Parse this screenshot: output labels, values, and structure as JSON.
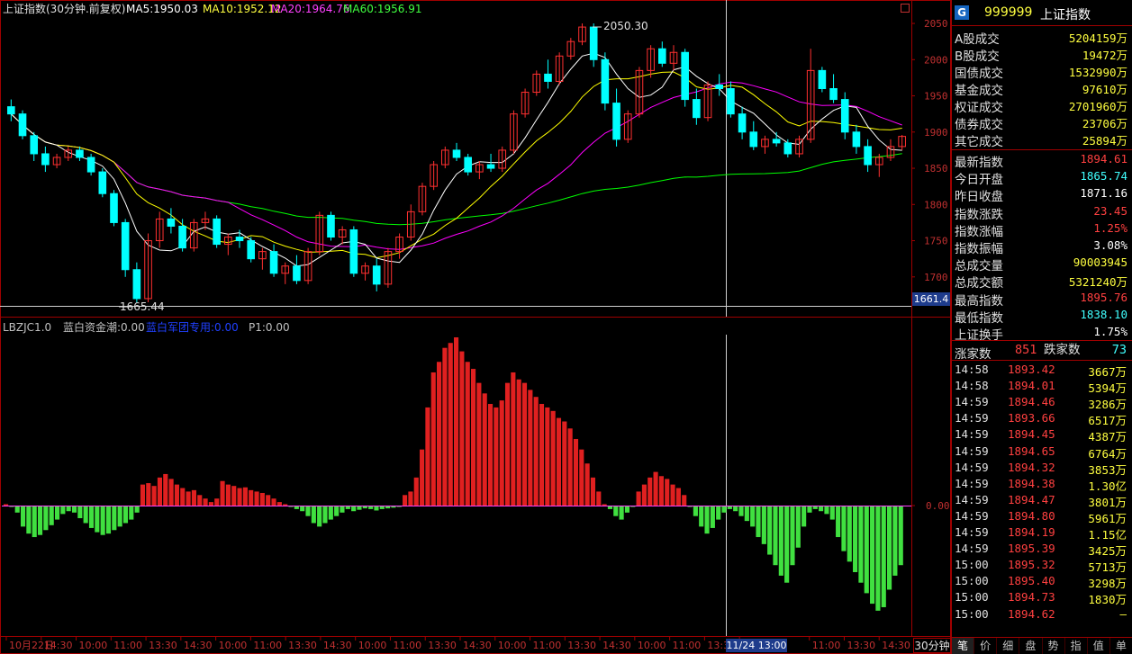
{
  "header": {
    "title": "上证指数(30分钟.前复权)",
    "ma5": "MA5:1950.03",
    "ma10": "MA10:1952.12",
    "ma20": "MA20:1964.76",
    "ma60": "MA60:1956.91"
  },
  "indicator_header": {
    "name": "LBZJC1.0",
    "lanbai": "蓝白资金潮:0.00",
    "team": "蓝白军团专用:0.00",
    "p1": "P1:0.00"
  },
  "annotations": {
    "high": "2050.30",
    "low": "1665.44",
    "crosshair_price": "1661.4",
    "crosshair_time": "11/24 13:00",
    "period_button": "30分钟"
  },
  "colors": {
    "up": "#ff3030",
    "down": "#00ffff",
    "ma5": "#ffffff",
    "ma10": "#ffff00",
    "ma20": "#ff00ff",
    "ma60": "#00ff00",
    "grid": "#a00000",
    "hist_up": "#e02020",
    "hist_down": "#40e040"
  },
  "panel": {
    "badge": "G",
    "code": "999999",
    "name": "上证指数",
    "stats": [
      {
        "label": "A股成交",
        "value": "5204159万",
        "color": "yellow"
      },
      {
        "label": "B股成交",
        "value": "19472万",
        "color": "yellow"
      },
      {
        "label": "国债成交",
        "value": "1532990万",
        "color": "yellow"
      },
      {
        "label": "基金成交",
        "value": "97610万",
        "color": "yellow"
      },
      {
        "label": "权证成交",
        "value": "2701960万",
        "color": "yellow"
      },
      {
        "label": "债券成交",
        "value": "23706万",
        "color": "yellow"
      },
      {
        "label": "其它成交",
        "value": "25894万",
        "color": "yellow"
      }
    ],
    "quotes": [
      {
        "label": "最新指数",
        "value": "1894.61",
        "color": "red"
      },
      {
        "label": "今日开盘",
        "value": "1865.74",
        "color": "cyan"
      },
      {
        "label": "昨日收盘",
        "value": "1871.16",
        "color": "white"
      },
      {
        "label": "指数涨跌",
        "value": "23.45",
        "color": "red"
      },
      {
        "label": "指数涨幅",
        "value": "1.25%",
        "color": "red"
      },
      {
        "label": "指数振幅",
        "value": "3.08%",
        "color": "white"
      },
      {
        "label": "总成交量",
        "value": "90003945",
        "color": "yellow"
      },
      {
        "label": "总成交额",
        "value": "5321240万",
        "color": "yellow"
      },
      {
        "label": "最高指数",
        "value": "1895.76",
        "color": "red"
      },
      {
        "label": "最低指数",
        "value": "1838.10",
        "color": "cyan"
      },
      {
        "label": "上证换手",
        "value": "1.75%",
        "color": "white"
      }
    ],
    "breadth": {
      "up_label": "涨家数",
      "up_value": "851",
      "down_label": "跌家数",
      "down_value": "73"
    },
    "ticks": [
      {
        "time": "14:58",
        "price": "1893.42",
        "vol": "3667万"
      },
      {
        "time": "14:58",
        "price": "1894.01",
        "vol": "5394万"
      },
      {
        "time": "14:59",
        "price": "1894.46",
        "vol": "3286万"
      },
      {
        "time": "14:59",
        "price": "1893.66",
        "vol": "6517万"
      },
      {
        "time": "14:59",
        "price": "1894.45",
        "vol": "4387万"
      },
      {
        "time": "14:59",
        "price": "1894.65",
        "vol": "6764万"
      },
      {
        "time": "14:59",
        "price": "1894.32",
        "vol": "3853万"
      },
      {
        "time": "14:59",
        "price": "1894.38",
        "vol": "1.30亿"
      },
      {
        "time": "14:59",
        "price": "1894.47",
        "vol": "3801万"
      },
      {
        "time": "14:59",
        "price": "1894.80",
        "vol": "5961万"
      },
      {
        "time": "14:59",
        "price": "1894.19",
        "vol": "1.15亿"
      },
      {
        "time": "14:59",
        "price": "1895.39",
        "vol": "3425万"
      },
      {
        "time": "15:00",
        "price": "1895.32",
        "vol": "5713万"
      },
      {
        "time": "15:00",
        "price": "1895.40",
        "vol": "3298万"
      },
      {
        "time": "15:00",
        "price": "1894.73",
        "vol": "1830万"
      },
      {
        "time": "15:00",
        "price": "1894.62",
        "vol": "—"
      }
    ],
    "tabs": [
      "笔",
      "价",
      "细",
      "盘",
      "势",
      "指",
      "值",
      "单"
    ]
  },
  "chart_data": [
    {
      "type": "candlestick",
      "title": "上证指数(30分钟.前复权)",
      "y_ticks": [
        "2050",
        "2000",
        "1950",
        "1900",
        "1850",
        "1800",
        "1750",
        "1700"
      ],
      "ylim": [
        1660,
        2060
      ],
      "x_ticks": [
        "10月22日",
        "14:30",
        "10:00",
        "11:00",
        "13:30",
        "14:30",
        "10:00",
        "11:00",
        "13:30",
        "14:30",
        "10:00",
        "11:00",
        "13:30",
        "14:30",
        "10:00",
        "11:00",
        "13:30",
        "14:30",
        "10:00",
        "11:00",
        "13:30",
        "14:30",
        "11/24 13:00",
        "11:00",
        "13:30",
        "14:30"
      ],
      "ohlc": [
        [
          1935,
          1945,
          1915,
          1925
        ],
        [
          1925,
          1930,
          1890,
          1895
        ],
        [
          1895,
          1900,
          1860,
          1870
        ],
        [
          1870,
          1880,
          1845,
          1855
        ],
        [
          1855,
          1870,
          1850,
          1865
        ],
        [
          1865,
          1880,
          1860,
          1875
        ],
        [
          1875,
          1880,
          1860,
          1865
        ],
        [
          1865,
          1870,
          1840,
          1845
        ],
        [
          1845,
          1850,
          1810,
          1815
        ],
        [
          1815,
          1820,
          1770,
          1775
        ],
        [
          1775,
          1780,
          1700,
          1710
        ],
        [
          1710,
          1720,
          1665,
          1670
        ],
        [
          1670,
          1760,
          1665,
          1750
        ],
        [
          1750,
          1790,
          1740,
          1780
        ],
        [
          1780,
          1795,
          1760,
          1770
        ],
        [
          1770,
          1780,
          1735,
          1740
        ],
        [
          1740,
          1780,
          1735,
          1775
        ],
        [
          1775,
          1790,
          1765,
          1780
        ],
        [
          1780,
          1785,
          1740,
          1745
        ],
        [
          1745,
          1760,
          1730,
          1755
        ],
        [
          1755,
          1765,
          1740,
          1750
        ],
        [
          1750,
          1755,
          1720,
          1725
        ],
        [
          1725,
          1740,
          1710,
          1735
        ],
        [
          1735,
          1745,
          1700,
          1705
        ],
        [
          1705,
          1720,
          1690,
          1715
        ],
        [
          1715,
          1730,
          1690,
          1695
        ],
        [
          1695,
          1740,
          1690,
          1735
        ],
        [
          1735,
          1790,
          1730,
          1785
        ],
        [
          1785,
          1790,
          1750,
          1755
        ],
        [
          1755,
          1770,
          1745,
          1765
        ],
        [
          1765,
          1770,
          1700,
          1705
        ],
        [
          1705,
          1720,
          1695,
          1715
        ],
        [
          1715,
          1725,
          1680,
          1690
        ],
        [
          1690,
          1740,
          1685,
          1735
        ],
        [
          1735,
          1760,
          1725,
          1755
        ],
        [
          1755,
          1800,
          1750,
          1790
        ],
        [
          1790,
          1830,
          1785,
          1825
        ],
        [
          1825,
          1860,
          1820,
          1855
        ],
        [
          1855,
          1880,
          1850,
          1875
        ],
        [
          1875,
          1885,
          1860,
          1865
        ],
        [
          1865,
          1870,
          1840,
          1845
        ],
        [
          1845,
          1860,
          1835,
          1855
        ],
        [
          1855,
          1870,
          1845,
          1850
        ],
        [
          1850,
          1880,
          1845,
          1875
        ],
        [
          1875,
          1930,
          1870,
          1925
        ],
        [
          1925,
          1960,
          1920,
          1955
        ],
        [
          1955,
          1985,
          1950,
          1980
        ],
        [
          1980,
          2000,
          1960,
          1970
        ],
        [
          1970,
          2010,
          1965,
          2005
        ],
        [
          2005,
          2030,
          2000,
          2025
        ],
        [
          2025,
          2050,
          2020,
          2045
        ],
        [
          2045,
          2050,
          1990,
          2000
        ],
        [
          2000,
          2010,
          1930,
          1940
        ],
        [
          1940,
          1960,
          1880,
          1890
        ],
        [
          1890,
          1930,
          1885,
          1925
        ],
        [
          1925,
          1990,
          1920,
          1985
        ],
        [
          1985,
          2020,
          1975,
          2015
        ],
        [
          2015,
          2025,
          1990,
          1995
        ],
        [
          1995,
          2020,
          1985,
          2010
        ],
        [
          2010,
          2015,
          1935,
          1945
        ],
        [
          1945,
          1960,
          1910,
          1920
        ],
        [
          1920,
          1970,
          1915,
          1965
        ],
        [
          1965,
          1980,
          1950,
          1960
        ],
        [
          1960,
          1970,
          1920,
          1925
        ],
        [
          1925,
          1935,
          1890,
          1900
        ],
        [
          1900,
          1915,
          1875,
          1880
        ],
        [
          1880,
          1895,
          1870,
          1890
        ],
        [
          1890,
          1900,
          1880,
          1885
        ],
        [
          1885,
          1890,
          1865,
          1870
        ],
        [
          1870,
          1895,
          1865,
          1890
        ],
        [
          1890,
          2015,
          1885,
          1985
        ],
        [
          1985,
          1990,
          1955,
          1960
        ],
        [
          1960,
          1980,
          1940,
          1945
        ],
        [
          1945,
          1955,
          1890,
          1900
        ],
        [
          1900,
          1910,
          1870,
          1880
        ],
        [
          1880,
          1890,
          1845,
          1855
        ],
        [
          1855,
          1870,
          1838,
          1865
        ],
        [
          1865,
          1890,
          1860,
          1880
        ],
        [
          1880,
          1896,
          1875,
          1894
        ]
      ]
    },
    {
      "type": "bar",
      "title": "LBZJC1.0",
      "y_ticks": [
        "0.00"
      ],
      "values": [
        2,
        -2,
        -10,
        -30,
        -40,
        -45,
        -42,
        -35,
        -28,
        -20,
        -12,
        -8,
        -10,
        -18,
        -25,
        -32,
        -38,
        -42,
        -40,
        -35,
        -30,
        -25,
        -20,
        -10,
        30,
        32,
        28,
        40,
        45,
        38,
        30,
        25,
        20,
        22,
        15,
        10,
        5,
        10,
        35,
        30,
        28,
        25,
        26,
        22,
        20,
        18,
        15,
        10,
        5,
        2,
        -2,
        -5,
        -8,
        -15,
        -25,
        -30,
        -25,
        -20,
        -15,
        -10,
        -5,
        -8,
        -6,
        -4,
        -5,
        -7,
        -5,
        -4,
        -3,
        -2,
        15,
        20,
        40,
        80,
        140,
        190,
        205,
        225,
        232,
        240,
        220,
        205,
        195,
        175,
        160,
        145,
        140,
        150,
        175,
        190,
        180,
        175,
        165,
        155,
        145,
        140,
        135,
        125,
        120,
        110,
        95,
        80,
        60,
        40,
        20,
        2,
        -5,
        -15,
        -20,
        -10,
        -2,
        20,
        30,
        40,
        48,
        42,
        38,
        30,
        25,
        15,
        -2,
        -15,
        -30,
        -40,
        -32,
        -20,
        -10,
        -5,
        -8,
        -15,
        -22,
        -30,
        -45,
        -55,
        -70,
        -85,
        -100,
        -110,
        -85,
        -60,
        -30,
        -10,
        -5,
        -8,
        -12,
        -20,
        -45,
        -65,
        -80,
        -95,
        -110,
        -125,
        -140,
        -150,
        -145,
        -120,
        -100,
        -85
      ]
    }
  ]
}
